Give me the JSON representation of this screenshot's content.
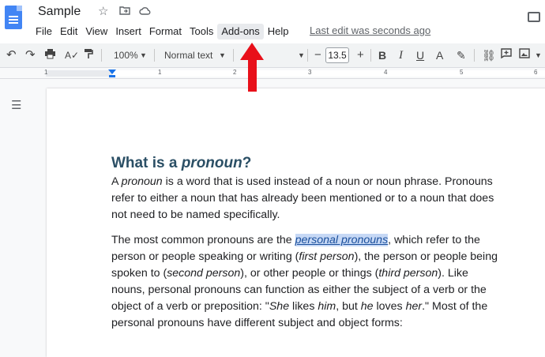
{
  "header": {
    "title": "Sample",
    "last_edit": "Last edit was seconds ago",
    "menu": [
      "File",
      "Edit",
      "View",
      "Insert",
      "Format",
      "Tools",
      "Add-ons",
      "Help"
    ],
    "active_menu": "Add-ons"
  },
  "toolbar": {
    "zoom": "100%",
    "style": "Normal text",
    "font_size": "13.5",
    "bold": "B",
    "italic": "I",
    "underline": "U",
    "text_color": "A",
    "minus": "−",
    "plus": "+"
  },
  "ruler": {
    "numbers": [
      "1",
      "1",
      "2",
      "3",
      "4",
      "5",
      "6"
    ]
  },
  "document": {
    "heading_prefix": "What is a ",
    "heading_italic": "pronoun",
    "heading_suffix": "?",
    "p1": {
      "l1a": "A ",
      "l1i": "pronoun",
      "l1b": " is a word that is used instead of a noun or noun phrase. Pronouns",
      "l2": "refer to either a noun that has already been mentioned or to a noun that does",
      "l3": "not need to be named specifically."
    },
    "p2": {
      "l1a": "The most common pronouns are the ",
      "l1link": "personal pronouns",
      "l1b": ", which refer to the",
      "l2a": "person or people speaking or writing (",
      "l2i": "first person",
      "l2b": "), the person or people being",
      "l3a": "spoken to (",
      "l3i1": "second person",
      "l3b": "), or other people or things (",
      "l3i2": "third person",
      "l3c": "). Like",
      "l4": "nouns, personal pronouns can function as either the subject of a verb or the",
      "l5a": "object of a verb or preposition: \"",
      "l5i1": "She",
      "l5b": " likes ",
      "l5i2": "him",
      "l5c": ", but ",
      "l5i3": "he",
      "l5d": " loves ",
      "l5i4": "her",
      "l5e": ".\" Most of the",
      "l6": "personal pronouns have different subject and object forms:"
    }
  },
  "colors": {
    "accent": "#4285f4",
    "annotation_arrow": "#e8101a",
    "heading": "#2b4f65"
  }
}
